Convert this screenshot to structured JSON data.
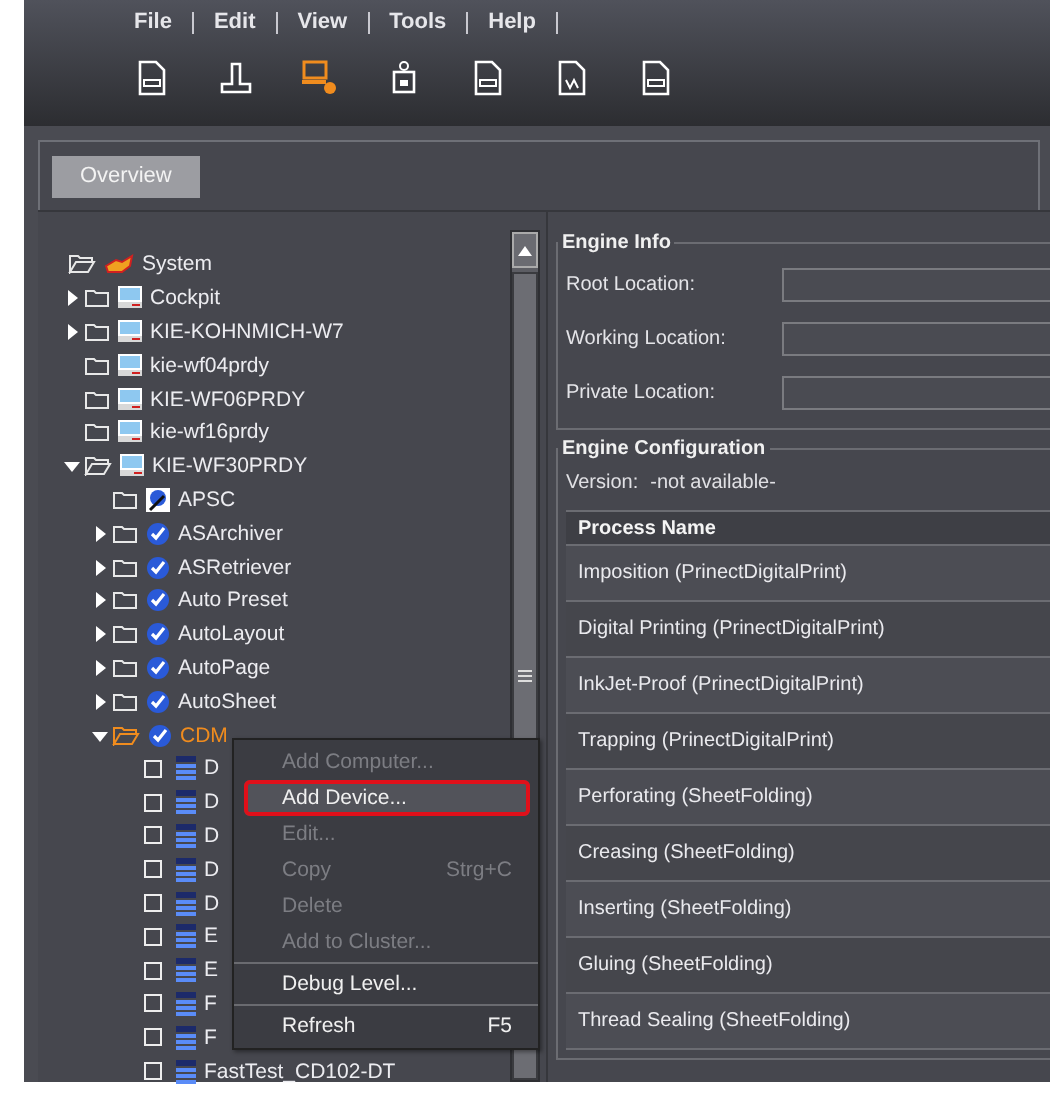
{
  "menu": [
    "File",
    "Edit",
    "View",
    "Tools",
    "Help"
  ],
  "toolbar": [
    {
      "kind": "doc",
      "selected": false
    },
    {
      "kind": "stamp",
      "selected": false
    },
    {
      "kind": "computer",
      "selected": true
    },
    {
      "kind": "robot",
      "selected": false
    },
    {
      "kind": "doc",
      "selected": false
    },
    {
      "kind": "doc",
      "selected": false
    },
    {
      "kind": "doc",
      "selected": false
    }
  ],
  "tabs": [
    {
      "label": "Overview",
      "selected": true
    }
  ],
  "tree": [
    {
      "label": "System",
      "kind": "system",
      "expanded": true,
      "selected": false,
      "children": [
        {
          "label": "Cockpit",
          "kind": "computer",
          "expanded": false,
          "selected": false
        },
        {
          "label": "KIE-KOHNMICH-W7",
          "kind": "computer",
          "expanded": false,
          "selected": false
        },
        {
          "label": "kie-wf04prdy",
          "kind": "computer",
          "selected": false
        },
        {
          "label": "KIE-WF06PRDY",
          "kind": "computer",
          "selected": false
        },
        {
          "label": "kie-wf16prdy",
          "kind": "computer",
          "selected": false
        },
        {
          "label": "KIE-WF30PRDY",
          "kind": "computer",
          "expanded": true,
          "selected": false,
          "children": [
            {
              "label": "APSC",
              "kind": "apsc",
              "selected": false
            },
            {
              "label": "ASArchiver",
              "kind": "service",
              "expanded": false,
              "selected": false
            },
            {
              "label": "ASRetriever",
              "kind": "service",
              "expanded": false,
              "selected": false
            },
            {
              "label": "Auto Preset",
              "kind": "service",
              "expanded": false,
              "selected": false
            },
            {
              "label": "AutoLayout",
              "kind": "service",
              "expanded": false,
              "selected": false
            },
            {
              "label": "AutoPage",
              "kind": "service",
              "expanded": false,
              "selected": false
            },
            {
              "label": "AutoSheet",
              "kind": "service",
              "expanded": false,
              "selected": false
            },
            {
              "label": "CDM",
              "kind": "service",
              "expanded": true,
              "selected": true,
              "children": [
                {
                  "label": "D",
                  "kind": "device",
                  "selected": false
                },
                {
                  "label": "D",
                  "kind": "device",
                  "selected": false
                },
                {
                  "label": "D",
                  "kind": "device",
                  "selected": false
                },
                {
                  "label": "D",
                  "kind": "device",
                  "selected": false
                },
                {
                  "label": "D",
                  "kind": "device",
                  "selected": false
                },
                {
                  "label": "E",
                  "kind": "device",
                  "selected": false
                },
                {
                  "label": "E",
                  "kind": "device",
                  "selected": false
                },
                {
                  "label": "F",
                  "kind": "device",
                  "selected": false
                },
                {
                  "label": "F",
                  "kind": "device",
                  "selected": false
                },
                {
                  "label": "FastTest_CD102-DT",
                  "kind": "device",
                  "selected": false
                }
              ]
            }
          ]
        }
      ]
    }
  ],
  "context_menu": [
    {
      "kind": "item",
      "label": "Add Computer...",
      "disabled": true,
      "selected": false
    },
    {
      "kind": "item",
      "label": "Add Device...",
      "disabled": false,
      "selected": true
    },
    {
      "kind": "item",
      "label": "Edit...",
      "disabled": true,
      "selected": false
    },
    {
      "kind": "item",
      "label": "Copy",
      "shortcut": "Strg+C",
      "disabled": true,
      "selected": false
    },
    {
      "kind": "item",
      "label": "Delete",
      "disabled": true,
      "selected": false
    },
    {
      "kind": "item",
      "label": "Add to Cluster...",
      "disabled": true,
      "selected": false
    },
    {
      "kind": "separator"
    },
    {
      "kind": "item",
      "label": "Debug Level...",
      "disabled": false,
      "selected": false
    },
    {
      "kind": "separator"
    },
    {
      "kind": "item",
      "label": "Refresh",
      "shortcut": "F5",
      "disabled": false,
      "selected": false
    }
  ],
  "engine_info": {
    "title": "Engine Info",
    "fields": [
      "Root Location:",
      "Working Location:",
      "Private Location:"
    ]
  },
  "engine_configuration": {
    "title": "Engine Configuration",
    "version_label": "Version:",
    "version": "-not available-",
    "table": {
      "columns": [
        "Process Name"
      ],
      "rows": [
        "Imposition (PrinectDigitalPrint)",
        "Digital Printing (PrinectDigitalPrint)",
        "InkJet-Proof (PrinectDigitalPrint)",
        "Trapping (PrinectDigitalPrint)",
        "Perforating (SheetFolding)",
        "Creasing (SheetFolding)",
        "Inserting (SheetFolding)",
        "Gluing (SheetFolding)",
        "Thread Sealing (SheetFolding)"
      ]
    }
  }
}
